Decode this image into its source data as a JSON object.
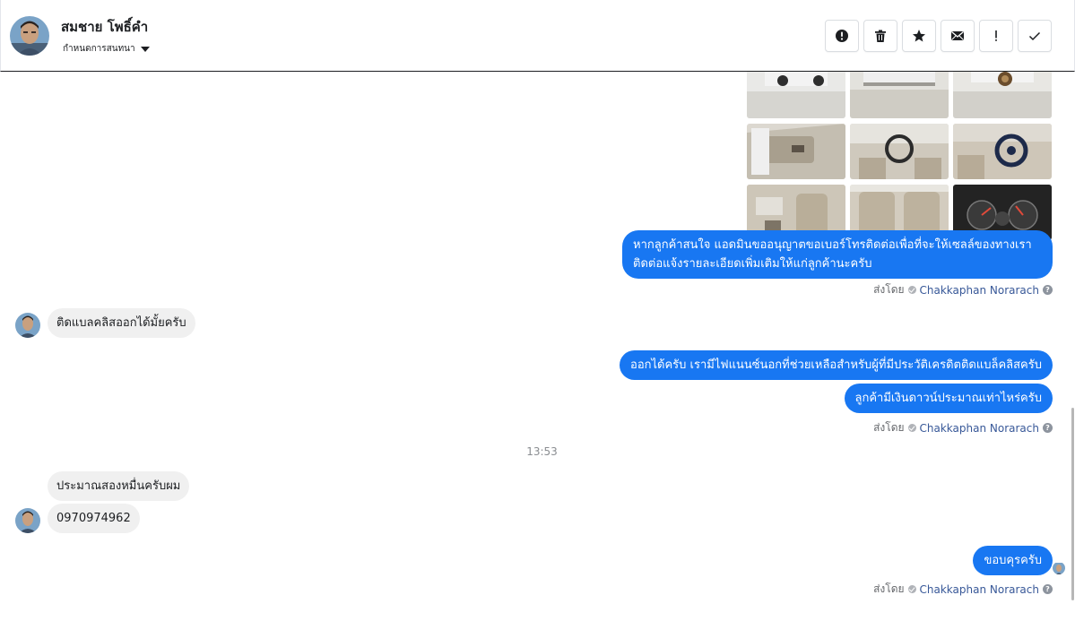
{
  "header": {
    "contact_name": "สมชาย โพธิ์คำ",
    "assign_label": "กำหนดการสนทนา",
    "toolbar": [
      {
        "name": "spam-alert-button",
        "icon": "alert-circle-icon"
      },
      {
        "name": "delete-button",
        "icon": "trash-icon"
      },
      {
        "name": "star-button",
        "icon": "star-icon"
      },
      {
        "name": "mark-unread-button",
        "icon": "envelope-icon"
      },
      {
        "name": "important-button",
        "icon": "exclamation-icon"
      },
      {
        "name": "mark-done-button",
        "icon": "checkmark-icon"
      }
    ]
  },
  "thread": {
    "msg1": "หากลูกค้าสนใจ แอดมินขออนุญาตขอเบอร์โทรติดต่อเพื่อที่จะให้เซลล์ของทางเรา",
    "msg1b": "ติดต่อแจ้งรายละเอียดเพิ่มเติมให้แก่ลูกค้านะครับ",
    "msg2": "ติดแบลคลิสออกได้มั้ยครับ",
    "msg3": "ออกได้ครับ เรามีไฟแนนซ์นอกที่ช่วยเหลือสำหรับผู้ที่มีประวัติเครดิตติดแบล็คลิสครับ",
    "msg4": "ลูกค้ามีเงินดาวน์ประมาณเท่าไหร่ครับ",
    "time": "13:53",
    "msg5": "ประมาณสองหมื่นครับผม",
    "msg6": "0970974962",
    "msg7": "ขอบคุรครับ",
    "sent_prefix": "ส่งโดย",
    "agent": "Chakkaphan Norarach",
    "help": "?"
  },
  "colors": {
    "brand": "#1877f2",
    "incoming": "#f0f0f0",
    "link": "#385898"
  }
}
